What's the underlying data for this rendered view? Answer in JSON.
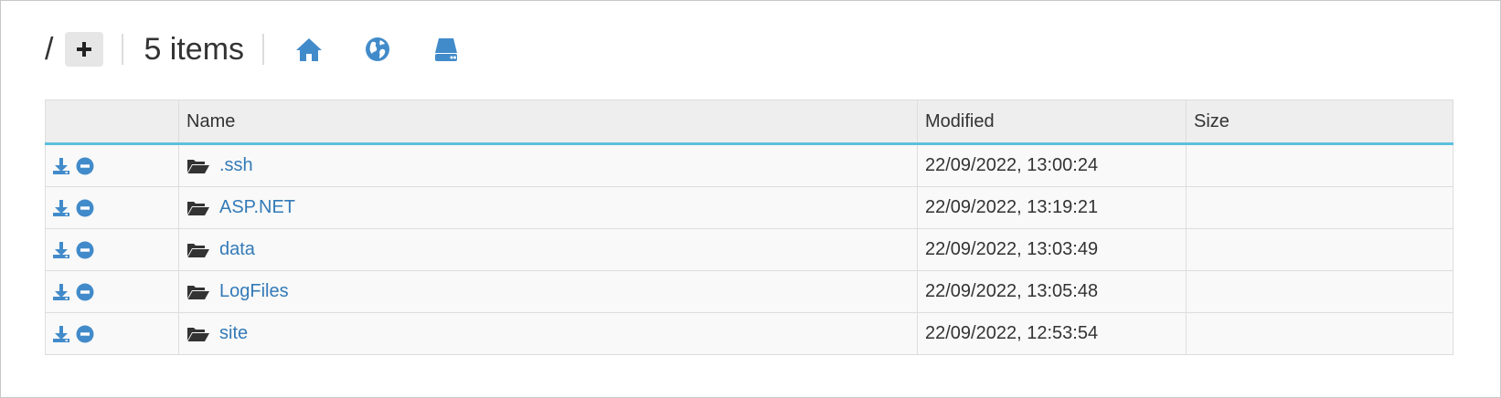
{
  "header": {
    "root_label": "/",
    "item_count": "5 items",
    "add_icon": "plus-icon",
    "home_icon": "home-icon",
    "globe_icon": "globe-icon",
    "drive_icon": "hard-drive-icon"
  },
  "table": {
    "columns": [
      "",
      "Name",
      "Modified",
      "Size"
    ],
    "rows": [
      {
        "name": ".ssh",
        "modified": "22/09/2022, 13:00:24",
        "size": ""
      },
      {
        "name": "ASP.NET",
        "modified": "22/09/2022, 13:19:21",
        "size": ""
      },
      {
        "name": "data",
        "modified": "22/09/2022, 13:03:49",
        "size": ""
      },
      {
        "name": "LogFiles",
        "modified": "22/09/2022, 13:05:48",
        "size": ""
      },
      {
        "name": "site",
        "modified": "22/09/2022, 12:53:54",
        "size": ""
      }
    ]
  },
  "colors": {
    "accent": "#337ab7",
    "header_underline": "#5bc0de",
    "icon_blue": "#428bca"
  }
}
